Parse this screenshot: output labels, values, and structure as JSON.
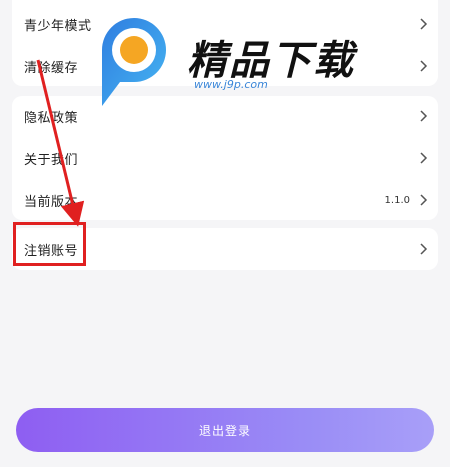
{
  "settings": {
    "group1": [
      {
        "label": "青少年模式"
      },
      {
        "label": "清除缓存"
      }
    ],
    "group2": [
      {
        "label": "隐私政策"
      },
      {
        "label": "关于我们"
      },
      {
        "label": "当前版本",
        "value": "1.1.0"
      }
    ],
    "group3": [
      {
        "label": "注销账号"
      }
    ]
  },
  "logout_label": "退出登录",
  "watermark": {
    "name": "精品下载",
    "url": "www.j9p.com"
  },
  "colors": {
    "accent_start": "#8e5ef2",
    "accent_end": "#a89ff8",
    "annotation": "#e02020",
    "background": "#f5f5f7"
  }
}
